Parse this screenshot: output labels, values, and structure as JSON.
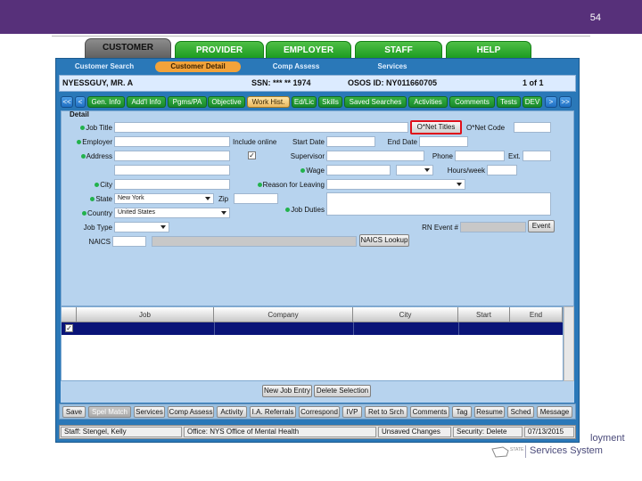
{
  "slide": {
    "number": "54"
  },
  "main_tabs": [
    "CUSTOMER",
    "PROVIDER",
    "EMPLOYER",
    "STAFF",
    "HELP"
  ],
  "sub_tabs": [
    "Customer Search",
    "Customer Detail",
    "Comp Assess",
    "Services"
  ],
  "info": {
    "name": "NYESSGUY, MR. A",
    "ssn": "SSN: *** ** 1974",
    "osos": "OSOS ID: NY011660705",
    "page": "1 of 1"
  },
  "nav_tabs": [
    "<<",
    "<",
    "Gen. Info",
    "Add'l Info",
    "Pgms/PA",
    "Objective",
    "Work Hist.",
    "Ed/Lic",
    "Skills",
    "Saved Searches",
    "Activities",
    "Comments",
    "Tests",
    "DEV",
    ">",
    ">>"
  ],
  "detail": {
    "legend": "Detail",
    "job_title": "Job Title",
    "onet_titles": "O*Net Titles",
    "onet_code": "O*Net Code",
    "employer": "Employer",
    "include_online": "Include online",
    "start_date": "Start Date",
    "end_date": "End Date",
    "address": "Address",
    "phone": "Phone",
    "ext": "Ext.",
    "supervisor": "Supervisor",
    "wage": "Wage",
    "hours_week": "Hours/week",
    "city": "City",
    "reason_leaving": "Reason for Leaving",
    "state": "State",
    "state_value": "New York",
    "zip": "Zip",
    "country": "Country",
    "country_value": "United States",
    "job_duties": "Job Duties",
    "job_type": "Job Type",
    "rn_event": "RN Event #",
    "event_btn": "Event",
    "naics": "NAICS",
    "naics_lookup": "NAICS Lookup"
  },
  "grid": {
    "headers": [
      "Job",
      "Company",
      "City",
      "Start",
      "End"
    ]
  },
  "actions": {
    "new_job": "New Job Entry",
    "delete": "Delete Selection"
  },
  "toolbar": [
    "Save",
    "Spel Match",
    "Services",
    "Comp Assess",
    "Activity",
    "I.A. Referrals",
    "Correspond",
    "IVP",
    "Ret to Srch",
    "Comments",
    "Tag",
    "Resume",
    "Sched",
    "Message"
  ],
  "status": {
    "staff": "Staff: Stengel, Kelly",
    "office": "Office: NYS Office of Mental Health",
    "unsaved": "Unsaved Changes",
    "security": "Security: Delete",
    "date": "07/13/2015"
  },
  "logo": {
    "line1": "loyment",
    "line2": "Services System",
    "mark": "STATE"
  }
}
